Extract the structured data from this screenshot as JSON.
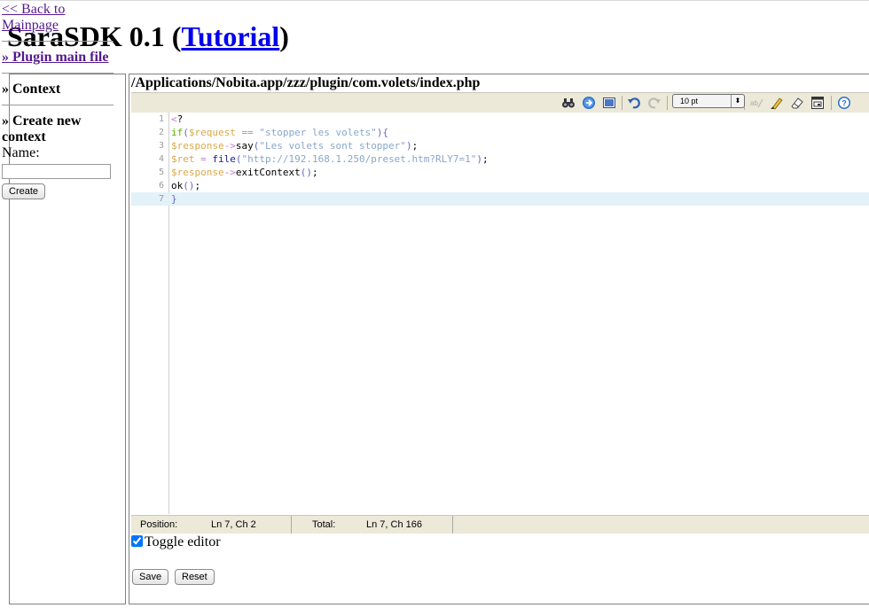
{
  "header": {
    "title_prefix": "SaraSDK 0.1 (",
    "title_link": "Tutorial",
    "title_suffix": ")"
  },
  "sidebar": {
    "back_link": "<< Back to Mainpage",
    "plugin_main_file": "» Plugin main file",
    "context": "» Context",
    "create_context": "» Create new context",
    "name_label": "Name:",
    "name_value": "",
    "create_button": "Create"
  },
  "editor": {
    "file_path": "/Applications/Nobita.app/zzz/plugin/com.volets/index.php",
    "font_size": "10 pt",
    "line_numbers": [
      "1",
      "2",
      "3",
      "4",
      "5",
      "6",
      "7"
    ],
    "toolbar_icons": [
      "search-icon",
      "goto-line-icon",
      "fullscreen-icon",
      "undo-icon",
      "redo-icon",
      "spellcheck-icon",
      "highlight-icon",
      "reset-highlight-icon",
      "syntax-toggle-icon",
      "help-icon"
    ]
  },
  "status": {
    "position_label": "Position:",
    "position_value": "Ln 7, Ch 2",
    "total_label": "Total:",
    "total_value": "Ln 7, Ch 166"
  },
  "controls": {
    "toggle_editor_label": "Toggle editor",
    "toggle_editor_checked": true,
    "save_button": "Save",
    "reset_button": "Reset"
  },
  "colors": {
    "link": "#0000ee",
    "visited_link": "#551a8b",
    "toolbar_bg": "#ece9d8",
    "active_line": "#e2f2f8"
  }
}
